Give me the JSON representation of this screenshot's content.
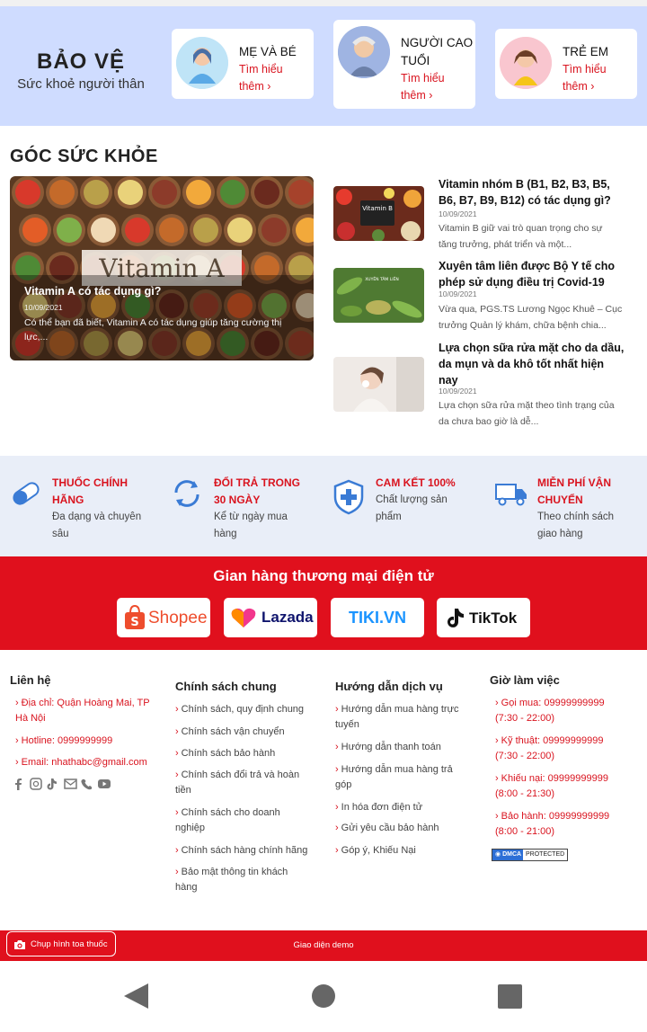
{
  "hero": {
    "title": "BẢO VỆ",
    "subtitle": "Sức khoẻ người thân",
    "cards": [
      {
        "title_lines": [
          "MẸ VÀ BÉ"
        ],
        "link_lines": [
          "Tìm hiểu",
          "thêm ›"
        ]
      },
      {
        "title_lines": [
          "NGƯỜI CAO",
          "TUỔI"
        ],
        "link_lines": [
          "Tìm hiểu",
          "thêm ›"
        ]
      },
      {
        "title_lines": [
          "TRẺ EM"
        ],
        "link_lines": [
          "Tìm hiểu",
          "thêm ›"
        ]
      }
    ]
  },
  "health": {
    "section_title": "GÓC SỨC KHỎE",
    "featured": {
      "image_text": "Vitamin A",
      "title": "Vitamin A có tác dụng gì?",
      "date": "10/09/2021",
      "desc": "Có thể bạn đã biết, Vitamin A có tác dụng giúp tăng cường thị lực,..."
    },
    "articles": [
      {
        "thumb_text": "Vitamin B",
        "title_lines": [
          "Vitamin nhóm B (B1, B2, B3, B5,",
          "B6, B7, B9, B12) có tác dụng gì?"
        ],
        "date": "10/09/2021",
        "desc_lines": [
          "Vitamin B giữ vai trò quan trọng cho sự",
          "tăng trưởng, phát triển và một..."
        ]
      },
      {
        "thumb_text": "XUYÊN TÂM LIÊN",
        "title_lines": [
          "Xuyên tâm liên được Bộ Y tế cho",
          "phép sử dụng điều trị Covid-19"
        ],
        "date": "10/09/2021",
        "desc_lines": [
          "Vừa qua, PGS.TS Lương Ngọc Khuê – Cục",
          "trưởng Quản lý khám, chữa bệnh chia..."
        ]
      },
      {
        "thumb_text": "",
        "title_lines": [
          "Lựa chọn sữa rửa mặt cho da dầu,",
          "da mụn và da khô tốt nhất hiện",
          "nay"
        ],
        "date": "10/09/2021",
        "desc_lines": [
          "Lựa chọn sữa rửa mặt theo tình trạng của",
          "da chưa bao giờ là dễ..."
        ]
      }
    ]
  },
  "benefits": [
    {
      "icon": "pill-capsule-icon",
      "title_lines": [
        "THUỐC CHÍNH",
        "HÃNG"
      ],
      "desc_lines": [
        "Đa dạng và chuyên",
        "sâu"
      ]
    },
    {
      "icon": "refresh-arrows-icon",
      "title_lines": [
        "ĐỔI TRẢ TRONG",
        "30 NGÀY"
      ],
      "desc_lines": [
        "Kể từ ngày mua",
        "hàng"
      ]
    },
    {
      "icon": "shield-plus-icon",
      "title_lines": [
        "CAM KẾT 100%"
      ],
      "desc_lines": [
        "Chất lượng sản",
        "phẩm"
      ]
    },
    {
      "icon": "delivery-truck-icon",
      "title_lines": [
        "MIỄN PHÍ VẬN",
        "CHUYỂN"
      ],
      "desc_lines": [
        "Theo chính sách",
        "giao hàng"
      ]
    }
  ],
  "market": {
    "title": "Gian hàng thương mại điện tử",
    "stores": [
      "Shopee",
      "Lazada",
      "TIKI.VN",
      "TikTok"
    ],
    "colors": {
      "shopee": "#ee4d2d",
      "lazada": "#0f146d",
      "tiki": "#1a94ff",
      "tiktok": "#111111"
    }
  },
  "footer": {
    "contact": {
      "title": "Liên hệ",
      "address_lines": [
        "Địa chỉ: Quận Hoàng Mai, TP",
        "Hà Nội"
      ],
      "hotline": "Hotline: 0999999999",
      "email": "Email: nhathabc@gmail.com",
      "socials": [
        "facebook-icon",
        "instagram-icon",
        "tiktok-icon",
        "email-icon",
        "phone-icon",
        "youtube-icon"
      ]
    },
    "policy": {
      "title": "Chính sách chung",
      "items": [
        [
          "Chính sách, quy định chung"
        ],
        [
          "Chính sách vận chuyển"
        ],
        [
          "Chính sách bảo hành"
        ],
        [
          "Chính sách đổi trả và hoàn",
          "tiền"
        ],
        [
          "Chính sách cho doanh",
          "nghiệp"
        ],
        [
          "Chính sách hàng chính hãng"
        ],
        [
          "Bảo mật thông tin khách",
          "hàng"
        ]
      ]
    },
    "guide": {
      "title": "Hướng dẫn dịch vụ",
      "items": [
        [
          "Hướng dẫn mua hàng trực",
          "tuyến"
        ],
        [
          "Hướng dẫn thanh toán"
        ],
        [
          "Hướng dẫn mua hàng trả",
          "góp"
        ],
        [
          "In hóa đơn điện tử"
        ],
        [
          "Gửi yêu cầu bảo hành"
        ],
        [
          "Góp ý, Khiếu Nại"
        ]
      ]
    },
    "hours": {
      "title": "Giờ làm việc",
      "items": [
        [
          "Gọi mua: 09999999999",
          "(7:30 - 22:00)"
        ],
        [
          "Kỹ thuật: 09999999999",
          "(7:30 - 22:00)"
        ],
        [
          "Khiếu nại: 09999999999",
          "(8:00 - 21:30)"
        ],
        [
          "Bảo hành: 09999999999",
          "(8:00 - 21:00)"
        ]
      ],
      "dmca": [
        "DMCA",
        "PROTECTED"
      ]
    }
  },
  "bottom": {
    "scan_button": "Chụp hình toa thuốc",
    "demo": "Giao diện demo"
  }
}
